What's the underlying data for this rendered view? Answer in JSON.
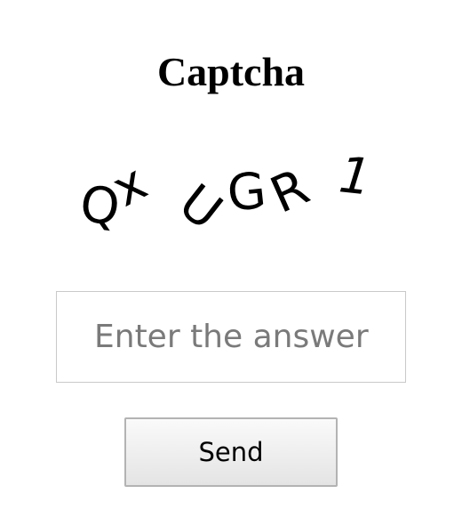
{
  "title": "Captcha",
  "captcha": {
    "characters": [
      "Q",
      "x",
      "U",
      "G",
      "R",
      "1"
    ]
  },
  "answer_input": {
    "placeholder": "Enter the answer",
    "value": ""
  },
  "send_button": {
    "label": "Send"
  }
}
